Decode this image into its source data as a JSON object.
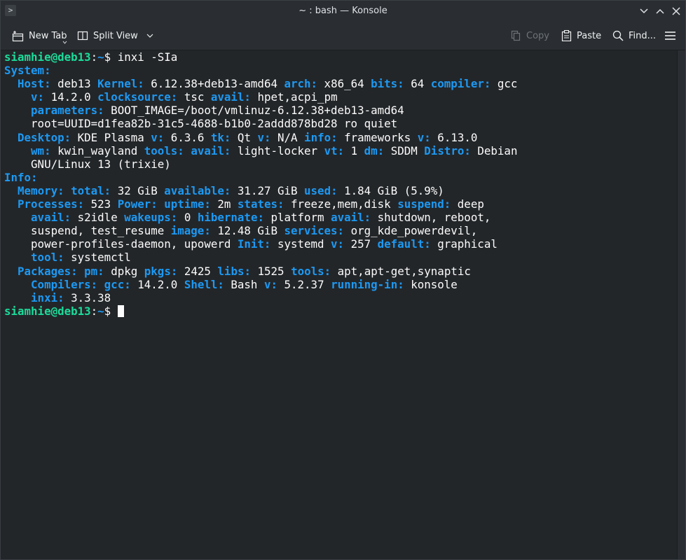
{
  "window": {
    "title": "~ : bash — Konsole",
    "app_icon_glyph": ">"
  },
  "toolbar": {
    "new_tab": "New Tab",
    "split_view": "Split View",
    "copy": "Copy",
    "paste": "Paste",
    "find": "Find..."
  },
  "icons": {
    "app": "terminal-icon",
    "minimize": "chevron-down-icon",
    "maximize": "chevron-up-icon",
    "close": "close-icon",
    "new_tab": "new-tab-icon",
    "split_view": "split-view-icon",
    "copy": "copy-icon",
    "paste": "paste-icon",
    "find": "search-icon",
    "menu": "hamburger-menu-icon"
  },
  "colors": {
    "background": "#232629",
    "text": "#fcfcfc",
    "key_blue": "#1d99f3",
    "prompt_green": "#1cdc9a"
  },
  "terminal": {
    "lines": [
      [
        {
          "t": "siamhie@deb13",
          "c": "p"
        },
        {
          "t": ":"
        },
        {
          "t": "~",
          "c": "k"
        },
        {
          "t": "$ inxi -SIa"
        }
      ],
      [
        {
          "t": "System:",
          "c": "k"
        }
      ],
      [
        {
          "t": "  "
        },
        {
          "t": "Host:",
          "c": "k"
        },
        {
          "t": " deb13 "
        },
        {
          "t": "Kernel:",
          "c": "k"
        },
        {
          "t": " 6.12.38+deb13-amd64 "
        },
        {
          "t": "arch:",
          "c": "k"
        },
        {
          "t": " x86_64 "
        },
        {
          "t": "bits:",
          "c": "k"
        },
        {
          "t": " 64 "
        },
        {
          "t": "compiler:",
          "c": "k"
        },
        {
          "t": " gcc"
        }
      ],
      [
        {
          "t": "    "
        },
        {
          "t": "v:",
          "c": "k"
        },
        {
          "t": " 14.2.0 "
        },
        {
          "t": "clocksource:",
          "c": "k"
        },
        {
          "t": " tsc "
        },
        {
          "t": "avail:",
          "c": "k"
        },
        {
          "t": " hpet,acpi_pm"
        }
      ],
      [
        {
          "t": "    "
        },
        {
          "t": "parameters:",
          "c": "k"
        },
        {
          "t": " BOOT_IMAGE=/boot/vmlinuz-6.12.38+deb13-amd64"
        }
      ],
      [
        {
          "t": "    root=UUID=d1fea82b-31c5-4688-b1b0-2addd878bd28 ro quiet"
        }
      ],
      [
        {
          "t": "  "
        },
        {
          "t": "Desktop:",
          "c": "k"
        },
        {
          "t": " KDE Plasma "
        },
        {
          "t": "v:",
          "c": "k"
        },
        {
          "t": " 6.3.6 "
        },
        {
          "t": "tk:",
          "c": "k"
        },
        {
          "t": " Qt "
        },
        {
          "t": "v:",
          "c": "k"
        },
        {
          "t": " N/A "
        },
        {
          "t": "info:",
          "c": "k"
        },
        {
          "t": " frameworks "
        },
        {
          "t": "v:",
          "c": "k"
        },
        {
          "t": " 6.13.0"
        }
      ],
      [
        {
          "t": "    "
        },
        {
          "t": "wm:",
          "c": "k"
        },
        {
          "t": " kwin_wayland "
        },
        {
          "t": "tools:",
          "c": "k"
        },
        {
          "t": " "
        },
        {
          "t": "avail:",
          "c": "k"
        },
        {
          "t": " light-locker "
        },
        {
          "t": "vt:",
          "c": "k"
        },
        {
          "t": " 1 "
        },
        {
          "t": "dm:",
          "c": "k"
        },
        {
          "t": " SDDM "
        },
        {
          "t": "Distro:",
          "c": "k"
        },
        {
          "t": " Debian"
        }
      ],
      [
        {
          "t": "    GNU/Linux 13 (trixie)"
        }
      ],
      [
        {
          "t": "Info:",
          "c": "k"
        }
      ],
      [
        {
          "t": "  "
        },
        {
          "t": "Memory:",
          "c": "k"
        },
        {
          "t": " "
        },
        {
          "t": "total:",
          "c": "k"
        },
        {
          "t": " 32 GiB "
        },
        {
          "t": "available:",
          "c": "k"
        },
        {
          "t": " 31.27 GiB "
        },
        {
          "t": "used:",
          "c": "k"
        },
        {
          "t": " 1.84 GiB (5.9%)"
        }
      ],
      [
        {
          "t": "  "
        },
        {
          "t": "Processes:",
          "c": "k"
        },
        {
          "t": " 523 "
        },
        {
          "t": "Power:",
          "c": "k"
        },
        {
          "t": " "
        },
        {
          "t": "uptime:",
          "c": "k"
        },
        {
          "t": " 2m "
        },
        {
          "t": "states:",
          "c": "k"
        },
        {
          "t": " freeze,mem,disk "
        },
        {
          "t": "suspend:",
          "c": "k"
        },
        {
          "t": " deep"
        }
      ],
      [
        {
          "t": "    "
        },
        {
          "t": "avail:",
          "c": "k"
        },
        {
          "t": " s2idle "
        },
        {
          "t": "wakeups:",
          "c": "k"
        },
        {
          "t": " 0 "
        },
        {
          "t": "hibernate:",
          "c": "k"
        },
        {
          "t": " platform "
        },
        {
          "t": "avail:",
          "c": "k"
        },
        {
          "t": " shutdown, reboot,"
        }
      ],
      [
        {
          "t": "    suspend, test_resume "
        },
        {
          "t": "image:",
          "c": "k"
        },
        {
          "t": " 12.48 GiB "
        },
        {
          "t": "services:",
          "c": "k"
        },
        {
          "t": " org_kde_powerdevil,"
        }
      ],
      [
        {
          "t": "    power-profiles-daemon, upowerd "
        },
        {
          "t": "Init:",
          "c": "k"
        },
        {
          "t": " systemd "
        },
        {
          "t": "v:",
          "c": "k"
        },
        {
          "t": " 257 "
        },
        {
          "t": "default:",
          "c": "k"
        },
        {
          "t": " graphical"
        }
      ],
      [
        {
          "t": "    "
        },
        {
          "t": "tool:",
          "c": "k"
        },
        {
          "t": " systemctl"
        }
      ],
      [
        {
          "t": "  "
        },
        {
          "t": "Packages:",
          "c": "k"
        },
        {
          "t": " "
        },
        {
          "t": "pm:",
          "c": "k"
        },
        {
          "t": " dpkg "
        },
        {
          "t": "pkgs:",
          "c": "k"
        },
        {
          "t": " 2425 "
        },
        {
          "t": "libs:",
          "c": "k"
        },
        {
          "t": " 1525 "
        },
        {
          "t": "tools:",
          "c": "k"
        },
        {
          "t": " apt,apt-get,synaptic"
        }
      ],
      [
        {
          "t": "    "
        },
        {
          "t": "Compilers:",
          "c": "k"
        },
        {
          "t": " "
        },
        {
          "t": "gcc:",
          "c": "k"
        },
        {
          "t": " 14.2.0 "
        },
        {
          "t": "Shell:",
          "c": "k"
        },
        {
          "t": " Bash "
        },
        {
          "t": "v:",
          "c": "k"
        },
        {
          "t": " 5.2.37 "
        },
        {
          "t": "running-in:",
          "c": "k"
        },
        {
          "t": " konsole"
        }
      ],
      [
        {
          "t": "    "
        },
        {
          "t": "inxi:",
          "c": "k"
        },
        {
          "t": " 3.3.38"
        }
      ],
      [
        {
          "t": "siamhie@deb13",
          "c": "p"
        },
        {
          "t": ":"
        },
        {
          "t": "~",
          "c": "k"
        },
        {
          "t": "$ "
        }
      ]
    ]
  }
}
